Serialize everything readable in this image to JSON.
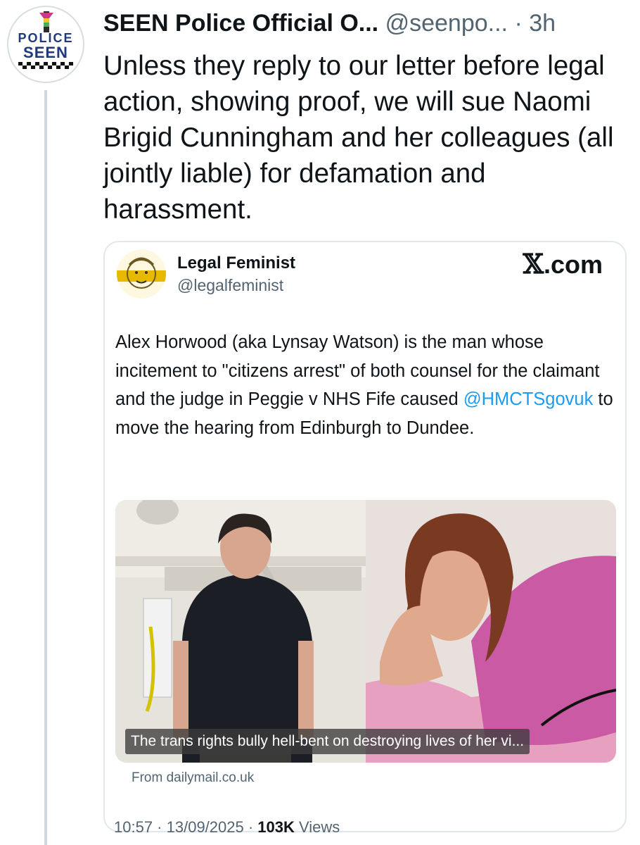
{
  "tweet": {
    "avatar_text_top": "POLICE",
    "avatar_text_bottom": "SEEN",
    "display_name": "SEEN Police Official O...",
    "handle": "@seenpo...",
    "separator": "·",
    "time": "3h",
    "text": "Unless they reply to our letter before legal action, showing proof, we will sue Naomi Brigid Cunningham and her colleagues (all jointly liable) for defamation and harassment."
  },
  "quote": {
    "display_name": "Legal Feminist",
    "handle": "@legalfeminist",
    "brand_x": "𝕏",
    "brand_com": ".com",
    "text_part1": "Alex Horwood (aka Lynsay Watson) is the man whose incitement to \"citizens arrest\" of both counsel for the claimant and the judge in Peggie v NHS Fife caused ",
    "mention": "@HMCTSgovuk",
    "text_part2": " to move the hearing from Edinburgh to Dundee.",
    "media_caption": "The trans rights bully hell-bent on destroying lives of her vi...",
    "source": "From dailymail.co.uk",
    "time": "10:57",
    "sep1": " · ",
    "date": "13/09/2025",
    "sep2": " · ",
    "views_count": "103K",
    "views_label": " Views"
  },
  "colors": {
    "link": "#1d9bf0",
    "secondary_text": "#536471",
    "primary_text": "#0f1419",
    "thread_line": "#cfd9de"
  }
}
